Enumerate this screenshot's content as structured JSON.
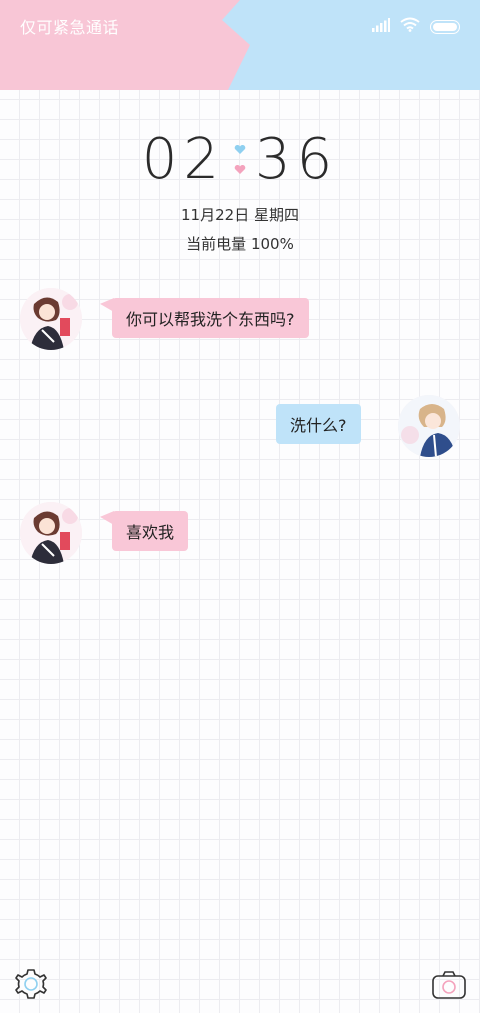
{
  "status_bar": {
    "emergency_text": "仅可紧急通话",
    "icons": [
      "signal-icon",
      "wifi-icon",
      "battery-icon"
    ]
  },
  "clock": {
    "hours": "02",
    "minutes": "36",
    "date": "11月22日 星期四",
    "battery": "当前电量 100%"
  },
  "chat": {
    "messages": [
      {
        "side": "left",
        "text": "你可以帮我洗个东西吗?"
      },
      {
        "side": "right",
        "text": "洗什么?"
      },
      {
        "side": "left",
        "text": "喜欢我"
      }
    ]
  },
  "bottom": {
    "left_icon": "settings-icon",
    "right_icon": "camera-icon"
  },
  "colors": {
    "pink": "#f8c6d6",
    "blue": "#bfe3f9",
    "text": "#2b2b2b"
  }
}
